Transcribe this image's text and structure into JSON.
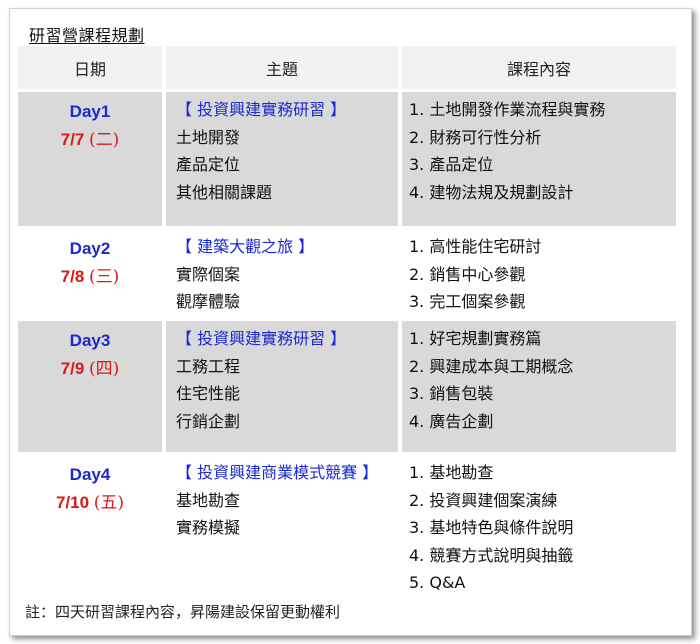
{
  "title": "研習營課程規劃",
  "headers": {
    "date": "日期",
    "topic": "主題",
    "content": "課程內容"
  },
  "rows": [
    {
      "day": "Day1",
      "date": "7/7",
      "weekday": "(二)",
      "topic_head": "【 投資興建實務研習 】",
      "topic_lines": [
        "土地開發",
        "產品定位",
        "其他相關課題"
      ],
      "content": [
        "1. 土地開發作業流程與實務",
        "2. 財務可行性分析",
        "3. 產品定位",
        "4. 建物法規及規劃設計"
      ]
    },
    {
      "day": "Day2",
      "date": "7/8",
      "weekday": "(三)",
      "topic_head": "【 建築大觀之旅 】",
      "topic_lines": [
        "實際個案",
        "觀摩體驗"
      ],
      "content": [
        "1. 高性能住宅研討",
        "2. 銷售中心參觀",
        "3. 完工個案參觀"
      ]
    },
    {
      "day": "Day3",
      "date": "7/9",
      "weekday": "(四)",
      "topic_head": "【 投資興建實務研習 】",
      "topic_lines": [
        "工務工程",
        "住宅性能",
        "行銷企劃"
      ],
      "content": [
        "1. 好宅規劃實務篇",
        "2. 興建成本與工期概念",
        "3. 銷售包裝",
        "4. 廣告企劃"
      ]
    },
    {
      "day": "Day4",
      "date": "7/10",
      "weekday": "(五)",
      "topic_head": "【 投資興建商業模式競賽 】",
      "topic_lines": [
        "基地勘查",
        "實務模擬"
      ],
      "content": [
        "1. 基地勘查",
        "2. 投資興建個案演練",
        "3. 基地特色與條件說明",
        "4. 競賽方式說明與抽籤",
        "5. Q&A"
      ]
    }
  ],
  "note": "註：四天研習課程內容，昇陽建設保留更動權利",
  "colors": {
    "header_bg": "#f2f2f2",
    "grey_row": "#d9d9d9",
    "day_blue": "#1a29d0",
    "date_red": "#d91a1a"
  }
}
